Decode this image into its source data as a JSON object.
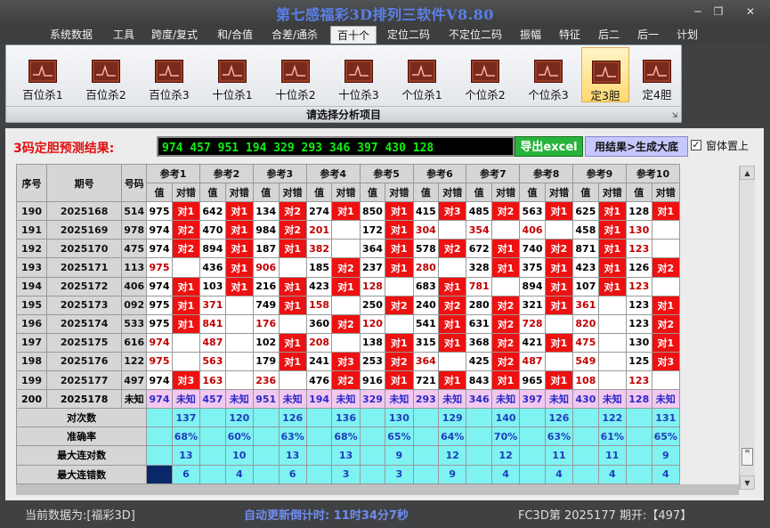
{
  "window": {
    "title": "第七感福彩3D排列三软件V8.80"
  },
  "menu": [
    "系统数据",
    "工具",
    "跨度/复式",
    "和/合值",
    "合差/通杀",
    "百十个",
    "定位二码",
    "不定位二码",
    "振幅",
    "特征",
    "后二",
    "后一",
    "计划"
  ],
  "active_menu": "百十个",
  "toolbar": {
    "items": [
      "百位杀1",
      "百位杀2",
      "百位杀3",
      "十位杀1",
      "十位杀2",
      "十位杀3",
      "个位杀1",
      "个位杀2",
      "个位杀3",
      "定3胆",
      "定4胆"
    ],
    "active": "定3胆",
    "caption": "请选择分析项目"
  },
  "prediction": {
    "label": "3码定胆预测结果:",
    "value": "974 457 951 194 329 293 346 397 430 128",
    "excel_button": "导出excel",
    "generate_button": "用结果>生成大底",
    "topmost_label": "窗体置上",
    "topmost_checked": true
  },
  "table": {
    "fixed_headers": [
      "序号",
      "期号",
      "号码"
    ],
    "ref_headers": [
      "参考1",
      "参考2",
      "参考3",
      "参考4",
      "参考5",
      "参考6",
      "参考7",
      "参考8",
      "参考9",
      "参考10"
    ],
    "sub_headers": [
      "值",
      "对错"
    ],
    "rows": [
      {
        "seq": "190",
        "issue": "2025168",
        "num": "514",
        "refs": [
          [
            "975",
            "K",
            "对1"
          ],
          [
            "642",
            "K",
            "对1"
          ],
          [
            "134",
            "K",
            "对2"
          ],
          [
            "274",
            "K",
            "对1"
          ],
          [
            "850",
            "K",
            "对1"
          ],
          [
            "415",
            "K",
            "对3"
          ],
          [
            "485",
            "K",
            "对2"
          ],
          [
            "563",
            "K",
            "对1"
          ],
          [
            "625",
            "K",
            "对1"
          ],
          [
            "128",
            "K",
            "对1"
          ]
        ]
      },
      {
        "seq": "191",
        "issue": "2025169",
        "num": "978",
        "refs": [
          [
            "974",
            "K",
            "对2"
          ],
          [
            "470",
            "K",
            "对1"
          ],
          [
            "984",
            "K",
            "对2"
          ],
          [
            "201",
            "R",
            ""
          ],
          [
            "172",
            "K",
            "对1"
          ],
          [
            "304",
            "R",
            ""
          ],
          [
            "354",
            "R",
            ""
          ],
          [
            "406",
            "R",
            ""
          ],
          [
            "458",
            "K",
            "对1"
          ],
          [
            "130",
            "R",
            ""
          ]
        ]
      },
      {
        "seq": "192",
        "issue": "2025170",
        "num": "475",
        "refs": [
          [
            "974",
            "K",
            "对2"
          ],
          [
            "894",
            "K",
            "对1"
          ],
          [
            "187",
            "K",
            "对1"
          ],
          [
            "382",
            "R",
            ""
          ],
          [
            "364",
            "K",
            "对1"
          ],
          [
            "578",
            "K",
            "对2"
          ],
          [
            "672",
            "K",
            "对1"
          ],
          [
            "740",
            "K",
            "对2"
          ],
          [
            "871",
            "K",
            "对1"
          ],
          [
            "123",
            "R",
            ""
          ]
        ]
      },
      {
        "seq": "193",
        "issue": "2025171",
        "num": "113",
        "refs": [
          [
            "975",
            "R",
            ""
          ],
          [
            "436",
            "K",
            "对1"
          ],
          [
            "906",
            "R",
            ""
          ],
          [
            "185",
            "K",
            "对2"
          ],
          [
            "237",
            "K",
            "对1"
          ],
          [
            "280",
            "R",
            ""
          ],
          [
            "328",
            "K",
            "对1"
          ],
          [
            "375",
            "K",
            "对1"
          ],
          [
            "423",
            "K",
            "对1"
          ],
          [
            "126",
            "K",
            "对2"
          ]
        ]
      },
      {
        "seq": "194",
        "issue": "2025172",
        "num": "406",
        "refs": [
          [
            "974",
            "K",
            "对1"
          ],
          [
            "103",
            "K",
            "对1"
          ],
          [
            "216",
            "K",
            "对1"
          ],
          [
            "423",
            "K",
            "对1"
          ],
          [
            "128",
            "R",
            ""
          ],
          [
            "683",
            "K",
            "对1"
          ],
          [
            "781",
            "R",
            ""
          ],
          [
            "894",
            "K",
            "对1"
          ],
          [
            "107",
            "K",
            "对1"
          ],
          [
            "123",
            "R",
            ""
          ]
        ]
      },
      {
        "seq": "195",
        "issue": "2025173",
        "num": "092",
        "refs": [
          [
            "975",
            "K",
            "对1"
          ],
          [
            "371",
            "R",
            ""
          ],
          [
            "749",
            "K",
            "对1"
          ],
          [
            "158",
            "R",
            ""
          ],
          [
            "250",
            "K",
            "对2"
          ],
          [
            "240",
            "K",
            "对2"
          ],
          [
            "280",
            "K",
            "对2"
          ],
          [
            "321",
            "K",
            "对1"
          ],
          [
            "361",
            "R",
            ""
          ],
          [
            "123",
            "K",
            "对1"
          ]
        ]
      },
      {
        "seq": "196",
        "issue": "2025174",
        "num": "533",
        "refs": [
          [
            "975",
            "K",
            "对1"
          ],
          [
            "841",
            "R",
            ""
          ],
          [
            "176",
            "R",
            ""
          ],
          [
            "360",
            "K",
            "对2"
          ],
          [
            "120",
            "R",
            ""
          ],
          [
            "541",
            "K",
            "对1"
          ],
          [
            "631",
            "K",
            "对2"
          ],
          [
            "728",
            "R",
            ""
          ],
          [
            "820",
            "R",
            ""
          ],
          [
            "123",
            "K",
            "对2"
          ]
        ]
      },
      {
        "seq": "197",
        "issue": "2025175",
        "num": "616",
        "refs": [
          [
            "974",
            "R",
            ""
          ],
          [
            "487",
            "R",
            ""
          ],
          [
            "102",
            "K",
            "对1"
          ],
          [
            "208",
            "R",
            ""
          ],
          [
            "138",
            "K",
            "对1"
          ],
          [
            "315",
            "K",
            "对1"
          ],
          [
            "368",
            "K",
            "对2"
          ],
          [
            "421",
            "K",
            "对1"
          ],
          [
            "475",
            "R",
            ""
          ],
          [
            "130",
            "K",
            "对1"
          ]
        ]
      },
      {
        "seq": "198",
        "issue": "2025176",
        "num": "122",
        "refs": [
          [
            "975",
            "R",
            ""
          ],
          [
            "563",
            "R",
            ""
          ],
          [
            "179",
            "K",
            "对1"
          ],
          [
            "241",
            "K",
            "对3"
          ],
          [
            "253",
            "K",
            "对2"
          ],
          [
            "364",
            "R",
            ""
          ],
          [
            "425",
            "K",
            "对2"
          ],
          [
            "487",
            "R",
            ""
          ],
          [
            "549",
            "R",
            ""
          ],
          [
            "125",
            "K",
            "对3"
          ]
        ]
      },
      {
        "seq": "199",
        "issue": "2025177",
        "num": "497",
        "refs": [
          [
            "974",
            "K",
            "对3"
          ],
          [
            "163",
            "R",
            ""
          ],
          [
            "236",
            "R",
            ""
          ],
          [
            "476",
            "K",
            "对2"
          ],
          [
            "916",
            "K",
            "对1"
          ],
          [
            "721",
            "K",
            "对1"
          ],
          [
            "843",
            "K",
            "对1"
          ],
          [
            "965",
            "K",
            "对1"
          ],
          [
            "108",
            "R",
            ""
          ],
          [
            "123",
            "R",
            ""
          ]
        ]
      }
    ],
    "last_row": {
      "seq": "200",
      "issue": "2025178",
      "num": "未知",
      "values": [
        "974",
        "457",
        "951",
        "194",
        "329",
        "293",
        "346",
        "397",
        "430",
        "128"
      ],
      "status": "未知"
    },
    "stats": [
      {
        "label": "对次数",
        "values": [
          "137",
          "120",
          "126",
          "136",
          "130",
          "129",
          "140",
          "126",
          "122",
          "131"
        ]
      },
      {
        "label": "准确率",
        "values": [
          "68%",
          "60%",
          "63%",
          "68%",
          "65%",
          "64%",
          "70%",
          "63%",
          "61%",
          "65%"
        ]
      },
      {
        "label": "最大连对数",
        "values": [
          "13",
          "10",
          "13",
          "13",
          "9",
          "12",
          "12",
          "11",
          "11",
          "9"
        ]
      },
      {
        "label": "最大连错数",
        "values": [
          "6",
          "4",
          "6",
          "3",
          "3",
          "9",
          "4",
          "4",
          "4",
          "4"
        ]
      }
    ]
  },
  "status": {
    "current_data": "当前数据为:[福彩3D]",
    "countdown": "自动更新倒计时: 11时34分7秒",
    "issue_info": "FC3D第 2025177 期开:【497】"
  },
  "icons": {
    "window_min": "minimize-icon",
    "window_max": "restore-icon",
    "window_close": "close-icon",
    "tool": "chart-icon"
  },
  "colors": {
    "hit": "#ee1111",
    "prediction_text": "#10f010",
    "stat_bg": "#7ff2f2",
    "last_row_bg": "#f3c8f0",
    "title": "#5a7fe8"
  }
}
